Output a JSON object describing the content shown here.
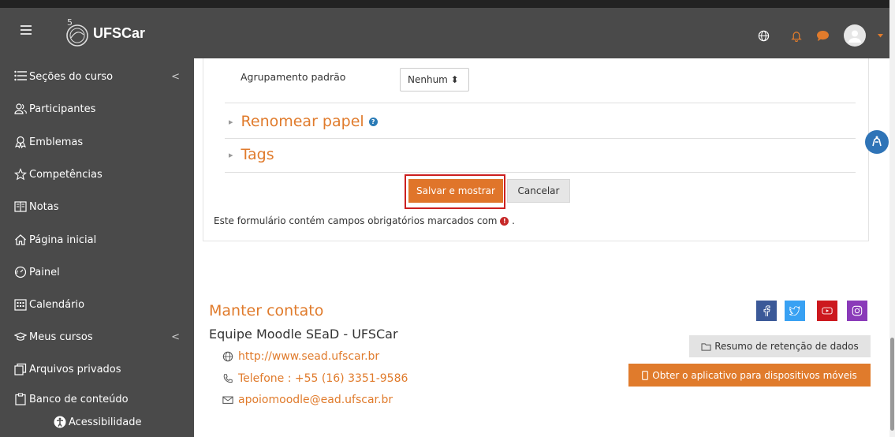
{
  "header": {
    "brand": "UFSCar"
  },
  "sidebar": {
    "items": [
      {
        "label": "Seções do curso",
        "icon": "list-icon",
        "chevron": "<"
      },
      {
        "label": "Participantes",
        "icon": "users-icon"
      },
      {
        "label": "Emblemas",
        "icon": "badge-icon"
      },
      {
        "label": "Competências",
        "icon": "star-icon"
      },
      {
        "label": "Notas",
        "icon": "gradebook-icon"
      },
      {
        "label": "Página inicial",
        "icon": "home-icon"
      },
      {
        "label": "Painel",
        "icon": "dashboard-icon"
      },
      {
        "label": "Calendário",
        "icon": "calendar-icon"
      },
      {
        "label": "Meus cursos",
        "icon": "graduation-cap-icon",
        "chevron": "<"
      },
      {
        "label": "Arquivos privados",
        "icon": "files-icon"
      },
      {
        "label": "Banco de conteúdo",
        "icon": "clipboard-icon"
      }
    ],
    "accessibility_label": "Acessibilidade"
  },
  "form": {
    "grouping_label": "Agrupamento padrão",
    "grouping_value": "Nenhum ⬍",
    "section_rename": "Renomear papel",
    "section_tags": "Tags",
    "save_label": "Salvar e mostrar",
    "cancel_label": "Cancelar",
    "required_note": "Este formulário contém campos obrigatórios marcados com",
    "required_note_end": "."
  },
  "footer": {
    "title": "Manter contato",
    "team": "Equipe Moodle SEaD - UFSCar",
    "website": "http://www.sead.ufscar.br",
    "phone": "Telefone : +55 (16) 3351-9586",
    "email": "apoiomoodle@ead.ufscar.br",
    "data_retention": "Resumo de retenção de dados",
    "mobile_app": "Obter o aplicativo para dispositivos móveis",
    "social": [
      "facebook-icon",
      "twitter-icon",
      "youtube-icon",
      "instagram-icon"
    ]
  },
  "colors": {
    "accent": "#e07b2c",
    "navbar": "#4a4a4a",
    "danger": "#c62828",
    "facebook": "#3b5998",
    "twitter": "#38a1f3",
    "youtube": "#cc181e",
    "instagram": "#8a3ab9"
  }
}
